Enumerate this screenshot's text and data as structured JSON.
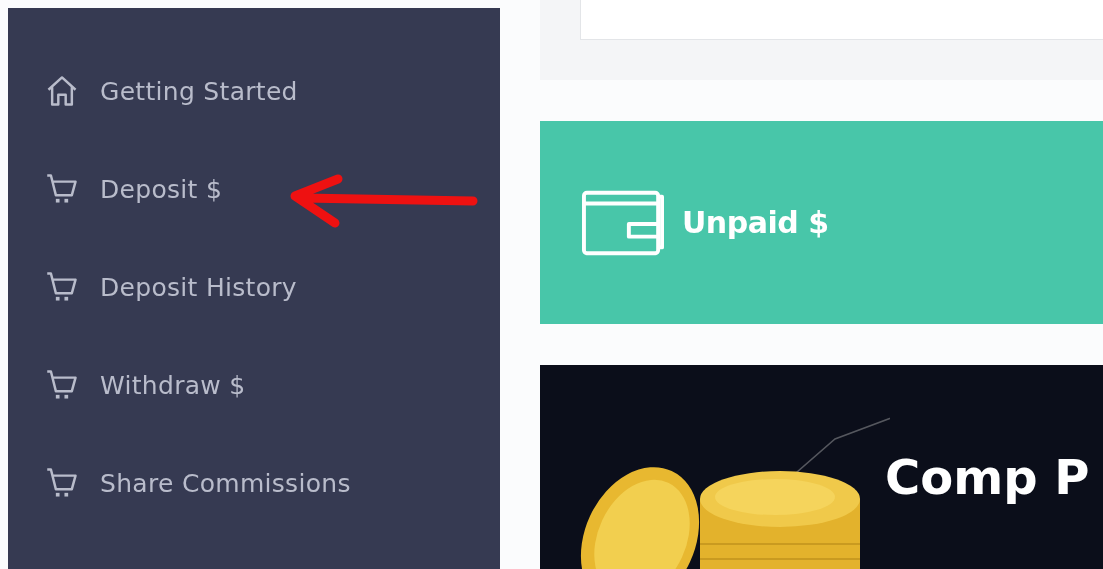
{
  "sidebar": {
    "items": [
      {
        "label": "Getting Started",
        "kind": "home"
      },
      {
        "label": "Deposit $",
        "kind": "cart"
      },
      {
        "label": "Deposit History",
        "kind": "cart"
      },
      {
        "label": "Withdraw $",
        "kind": "cart"
      },
      {
        "label": "Share Commissions",
        "kind": "cart"
      }
    ]
  },
  "unpaid_card": {
    "label": "Unpaid $"
  },
  "promo_banner": {
    "title": "Comp P"
  }
}
